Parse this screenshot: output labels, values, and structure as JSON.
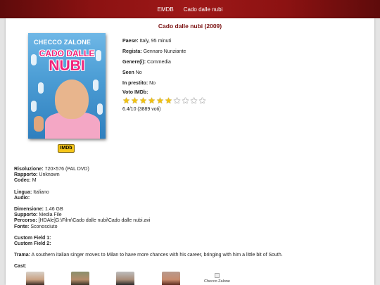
{
  "topbar": {
    "home_link": "EMDB",
    "current_link": "Cado dalle nubi"
  },
  "movie": {
    "title": "Cado dalle nubi (2009)",
    "poster": {
      "actor_text": "CHECCO ZALONE",
      "title_line1": "CADO DALLE",
      "title_line2": "NUBI"
    },
    "imdb_button": "IMDb"
  },
  "info": {
    "paese_label": "Paese:",
    "paese_value": "Italy, 95 minuti",
    "regista_label": "Regista:",
    "regista_value": "Gennaro Nunziante",
    "genere_label": "Genere(i):",
    "genere_value": "Commedia",
    "seen_label": "Seen",
    "seen_value": "No",
    "prestito_label": "In prestito:",
    "prestito_value": "No",
    "voto_label": "Voto IMDb:",
    "rating_stars_on": 6,
    "rating_stars_total": 10,
    "votes_text": "6.4/10 (3889 voti)"
  },
  "details": {
    "risoluzione_label": "Risoluzione:",
    "risoluzione_value": "720×576 (PAL DVD)",
    "rapporto_label": "Rapporto:",
    "rapporto_value": "Unknown",
    "codec_label": "Codec:",
    "codec_value": "M",
    "lingua_label": "Lingua:",
    "lingua_value": "Italiano",
    "audio_label": "Audio:",
    "audio_value": "",
    "dimensione_label": "Dimensione:",
    "dimensione_value": "1.46 GB",
    "supporto_label": "Supporto:",
    "supporto_value": "Media File",
    "percorso_label": "Percorso:",
    "percorso_value": "[HDAle]G:\\Film\\Cado dalle nubi\\Cado dalle nubi.avi",
    "fonte_label": "Fonte:",
    "fonte_value": "Sconosciuto",
    "custom1_label": "Custom Field 1:",
    "custom2_label": "Custom Field 2:",
    "trama_label": "Trama:",
    "trama_value": "A southern italian singer moves to Milan to have more chances with his career, bringing with him a little bit of South.",
    "cast_label": "Cast:"
  },
  "cast_members": [
    {
      "name": ""
    },
    {
      "name": ""
    },
    {
      "name": ""
    },
    {
      "name": ""
    },
    {
      "name": "Checco Zalone"
    }
  ]
}
